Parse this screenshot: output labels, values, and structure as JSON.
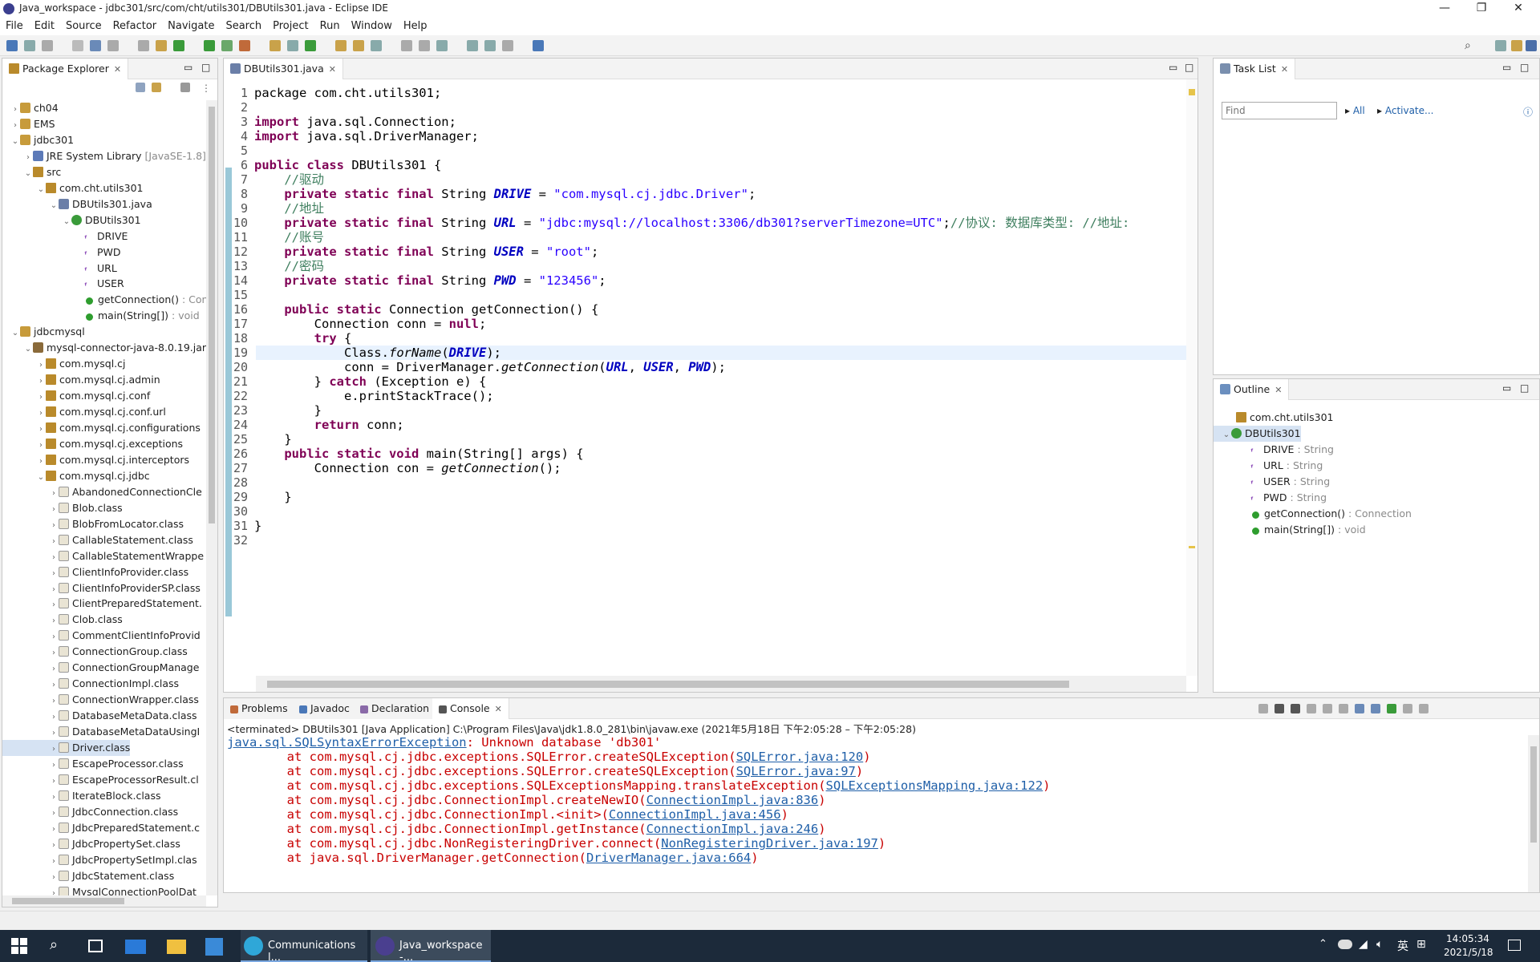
{
  "window": {
    "title": "Java_workspace - jdbc301/src/com/cht/utils301/DBUtils301.java - Eclipse IDE"
  },
  "menu": [
    "File",
    "Edit",
    "Source",
    "Refactor",
    "Navigate",
    "Search",
    "Project",
    "Run",
    "Window",
    "Help"
  ],
  "package_explorer": {
    "tab": "Package Explorer",
    "items": [
      {
        "label": "ch04",
        "depth": 0,
        "arrow": "›",
        "icon": "proj"
      },
      {
        "label": "EMS",
        "depth": 0,
        "arrow": "›",
        "icon": "proj"
      },
      {
        "label": "jdbc301",
        "depth": 0,
        "arrow": "⌄",
        "icon": "proj"
      },
      {
        "label": "JRE System Library",
        "extra": "[JavaSE-1.8]",
        "depth": 1,
        "arrow": "›",
        "icon": "lib"
      },
      {
        "label": "src",
        "depth": 1,
        "arrow": "⌄",
        "icon": "pkg"
      },
      {
        "label": "com.cht.utils301",
        "depth": 2,
        "arrow": "⌄",
        "icon": "pkg"
      },
      {
        "label": "DBUtils301.java",
        "depth": 3,
        "arrow": "⌄",
        "icon": "java"
      },
      {
        "label": "DBUtils301",
        "depth": 4,
        "arrow": "⌄",
        "icon": "class"
      },
      {
        "label": "DRIVE",
        "depth": 5,
        "arrow": "",
        "icon": "field"
      },
      {
        "label": "PWD",
        "depth": 5,
        "arrow": "",
        "icon": "field"
      },
      {
        "label": "URL",
        "depth": 5,
        "arrow": "",
        "icon": "field"
      },
      {
        "label": "USER",
        "depth": 5,
        "arrow": "",
        "icon": "field"
      },
      {
        "label": "getConnection()",
        "extra": ": Conn",
        "depth": 5,
        "arrow": "",
        "icon": "method"
      },
      {
        "label": "main(String[])",
        "extra": ": void",
        "depth": 5,
        "arrow": "",
        "icon": "method"
      },
      {
        "label": "jdbcmysql",
        "depth": 0,
        "arrow": "⌄",
        "icon": "proj"
      },
      {
        "label": "mysql-connector-java-8.0.19.jar",
        "depth": 1,
        "arrow": "⌄",
        "icon": "jar"
      },
      {
        "label": "com.mysql.cj",
        "depth": 2,
        "arrow": "›",
        "icon": "pkg"
      },
      {
        "label": "com.mysql.cj.admin",
        "depth": 2,
        "arrow": "›",
        "icon": "pkg"
      },
      {
        "label": "com.mysql.cj.conf",
        "depth": 2,
        "arrow": "›",
        "icon": "pkg"
      },
      {
        "label": "com.mysql.cj.conf.url",
        "depth": 2,
        "arrow": "›",
        "icon": "pkg"
      },
      {
        "label": "com.mysql.cj.configurations",
        "depth": 2,
        "arrow": "›",
        "icon": "pkg"
      },
      {
        "label": "com.mysql.cj.exceptions",
        "depth": 2,
        "arrow": "›",
        "icon": "pkg"
      },
      {
        "label": "com.mysql.cj.interceptors",
        "depth": 2,
        "arrow": "›",
        "icon": "pkg"
      },
      {
        "label": "com.mysql.cj.jdbc",
        "depth": 2,
        "arrow": "⌄",
        "icon": "pkg"
      },
      {
        "label": "AbandonedConnectionCle",
        "depth": 3,
        "arrow": "›",
        "icon": "file"
      },
      {
        "label": "Blob.class",
        "depth": 3,
        "arrow": "›",
        "icon": "file"
      },
      {
        "label": "BlobFromLocator.class",
        "depth": 3,
        "arrow": "›",
        "icon": "file"
      },
      {
        "label": "CallableStatement.class",
        "depth": 3,
        "arrow": "›",
        "icon": "file"
      },
      {
        "label": "CallableStatementWrappe",
        "depth": 3,
        "arrow": "›",
        "icon": "file"
      },
      {
        "label": "ClientInfoProvider.class",
        "depth": 3,
        "arrow": "›",
        "icon": "file"
      },
      {
        "label": "ClientInfoProviderSP.class",
        "depth": 3,
        "arrow": "›",
        "icon": "file"
      },
      {
        "label": "ClientPreparedStatement.",
        "depth": 3,
        "arrow": "›",
        "icon": "file"
      },
      {
        "label": "Clob.class",
        "depth": 3,
        "arrow": "›",
        "icon": "file"
      },
      {
        "label": "CommentClientInfoProvid",
        "depth": 3,
        "arrow": "›",
        "icon": "file"
      },
      {
        "label": "ConnectionGroup.class",
        "depth": 3,
        "arrow": "›",
        "icon": "file"
      },
      {
        "label": "ConnectionGroupManage",
        "depth": 3,
        "arrow": "›",
        "icon": "file"
      },
      {
        "label": "ConnectionImpl.class",
        "depth": 3,
        "arrow": "›",
        "icon": "file"
      },
      {
        "label": "ConnectionWrapper.class",
        "depth": 3,
        "arrow": "›",
        "icon": "file"
      },
      {
        "label": "DatabaseMetaData.class",
        "depth": 3,
        "arrow": "›",
        "icon": "file"
      },
      {
        "label": "DatabaseMetaDataUsingI",
        "depth": 3,
        "arrow": "›",
        "icon": "file"
      },
      {
        "label": "Driver.class",
        "depth": 3,
        "arrow": "›",
        "icon": "file",
        "selected": true
      },
      {
        "label": "EscapeProcessor.class",
        "depth": 3,
        "arrow": "›",
        "icon": "file"
      },
      {
        "label": "EscapeProcessorResult.cl",
        "depth": 3,
        "arrow": "›",
        "icon": "file"
      },
      {
        "label": "IterateBlock.class",
        "depth": 3,
        "arrow": "›",
        "icon": "file"
      },
      {
        "label": "JdbcConnection.class",
        "depth": 3,
        "arrow": "›",
        "icon": "file"
      },
      {
        "label": "JdbcPreparedStatement.c",
        "depth": 3,
        "arrow": "›",
        "icon": "file"
      },
      {
        "label": "JdbcPropertySet.class",
        "depth": 3,
        "arrow": "›",
        "icon": "file"
      },
      {
        "label": "JdbcPropertySetImpl.clas",
        "depth": 3,
        "arrow": "›",
        "icon": "file"
      },
      {
        "label": "JdbcStatement.class",
        "depth": 3,
        "arrow": "›",
        "icon": "file"
      },
      {
        "label": "MysqlConnectionPoolDat",
        "depth": 3,
        "arrow": "›",
        "icon": "file"
      }
    ]
  },
  "editor": {
    "tab": "DBUtils301.java",
    "lines": [
      [
        [
          "",
          "package com.cht.utils301;"
        ]
      ],
      [],
      [
        [
          "kw",
          "import"
        ],
        [
          "",
          " java.sql.Connection;"
        ]
      ],
      [
        [
          "kw",
          "import"
        ],
        [
          "",
          " java.sql.DriverManager;"
        ]
      ],
      [],
      [
        [
          "kw",
          "public class"
        ],
        [
          "",
          " DBUtils301 {"
        ]
      ],
      [
        [
          "",
          "    "
        ],
        [
          "cm",
          "//驱动"
        ]
      ],
      [
        [
          "",
          "    "
        ],
        [
          "kw",
          "private static final"
        ],
        [
          "",
          " String "
        ],
        [
          "cn",
          "DRIVE"
        ],
        [
          "",
          " = "
        ],
        [
          "st",
          "\"com.mysql.cj.jdbc.Driver\""
        ],
        [
          "",
          ";"
        ]
      ],
      [
        [
          "",
          "    "
        ],
        [
          "cm",
          "//地址"
        ]
      ],
      [
        [
          "",
          "    "
        ],
        [
          "kw",
          "private static final"
        ],
        [
          "",
          " String "
        ],
        [
          "cn",
          "URL"
        ],
        [
          "",
          " = "
        ],
        [
          "st",
          "\"jdbc:mysql://localhost:3306/db301?serverTimezone=UTC\""
        ],
        [
          "",
          ";"
        ],
        [
          "cm",
          "//协议: 数据库类型: //地址:"
        ]
      ],
      [
        [
          "",
          "    "
        ],
        [
          "cm",
          "//账号"
        ]
      ],
      [
        [
          "",
          "    "
        ],
        [
          "kw",
          "private static final"
        ],
        [
          "",
          " String "
        ],
        [
          "cn",
          "USER"
        ],
        [
          "",
          " = "
        ],
        [
          "st",
          "\"root\""
        ],
        [
          "",
          ";"
        ]
      ],
      [
        [
          "",
          "    "
        ],
        [
          "cm",
          "//密码"
        ]
      ],
      [
        [
          "",
          "    "
        ],
        [
          "kw",
          "private static final"
        ],
        [
          "",
          " String "
        ],
        [
          "cn",
          "PWD"
        ],
        [
          "",
          " = "
        ],
        [
          "st",
          "\"123456\""
        ],
        [
          "",
          ";"
        ]
      ],
      [],
      [
        [
          "",
          "    "
        ],
        [
          "kw",
          "public static"
        ],
        [
          "",
          " Connection getConnection() {"
        ]
      ],
      [
        [
          "",
          "        Connection conn = "
        ],
        [
          "kw",
          "null"
        ],
        [
          "",
          ";"
        ]
      ],
      [
        [
          "",
          "        "
        ],
        [
          "kw",
          "try"
        ],
        [
          "",
          " {"
        ]
      ],
      [
        [
          "",
          "            Class."
        ],
        [
          "it",
          "forName"
        ],
        [
          "",
          "("
        ],
        [
          "cn",
          "DRIVE"
        ],
        [
          "",
          ");"
        ]
      ],
      [
        [
          "",
          "            conn = DriverManager."
        ],
        [
          "it",
          "getConnection"
        ],
        [
          "",
          "("
        ],
        [
          "cn",
          "URL"
        ],
        [
          "",
          ", "
        ],
        [
          "cn",
          "USER"
        ],
        [
          "",
          ", "
        ],
        [
          "cn",
          "PWD"
        ],
        [
          "",
          ");"
        ]
      ],
      [
        [
          "",
          "        } "
        ],
        [
          "kw",
          "catch"
        ],
        [
          "",
          " (Exception e) {"
        ]
      ],
      [
        [
          "",
          "            e.printStackTrace();"
        ]
      ],
      [
        [
          "",
          "        }"
        ]
      ],
      [
        [
          "",
          "        "
        ],
        [
          "kw",
          "return"
        ],
        [
          "",
          " conn;"
        ]
      ],
      [
        [
          "",
          "    }"
        ]
      ],
      [
        [
          "",
          "    "
        ],
        [
          "kw",
          "public static void"
        ],
        [
          "",
          " main(String[] args) {"
        ]
      ],
      [
        [
          "",
          "        Connection con = "
        ],
        [
          "it",
          "getConnection"
        ],
        [
          "",
          "();"
        ]
      ],
      [],
      [
        [
          "",
          "    }"
        ]
      ],
      [],
      [
        [
          "",
          "}"
        ]
      ],
      []
    ]
  },
  "task_list": {
    "tab": "Task List",
    "find_placeholder": "Find",
    "all": "All",
    "activate": "Activate..."
  },
  "outline": {
    "tab": "Outline",
    "items": [
      {
        "label": "com.cht.utils301",
        "type": "",
        "depth": 0,
        "icon": "pkg"
      },
      {
        "label": "DBUtils301",
        "type": "",
        "depth": 0,
        "icon": "class",
        "selected": true
      },
      {
        "label": "DRIVE",
        "type": ": String",
        "depth": 1,
        "icon": "field"
      },
      {
        "label": "URL",
        "type": ": String",
        "depth": 1,
        "icon": "field"
      },
      {
        "label": "USER",
        "type": ": String",
        "depth": 1,
        "icon": "field"
      },
      {
        "label": "PWD",
        "type": ": String",
        "depth": 1,
        "icon": "field"
      },
      {
        "label": "getConnection()",
        "type": ": Connection",
        "depth": 1,
        "icon": "method"
      },
      {
        "label": "main(String[])",
        "type": ": void",
        "depth": 1,
        "icon": "method"
      }
    ]
  },
  "bottom_tabs": [
    "Problems",
    "Javadoc",
    "Declaration",
    "Console"
  ],
  "console": {
    "header": "<terminated> DBUtils301 [Java Application] C:\\Program Files\\Java\\jdk1.8.0_281\\bin\\javaw.exe  (2021年5月18日 下午2:05:28 – 下午2:05:28)",
    "lines": [
      [
        [
          "lnk",
          "java.sql.SQLSyntaxErrorException"
        ],
        [
          "",
          ": Unknown database 'db301'"
        ]
      ],
      [
        [
          "",
          "        at com.mysql.cj.jdbc.exceptions.SQLError.createSQLException("
        ],
        [
          "lnk",
          "SQLError.java:120"
        ],
        [
          "",
          ")"
        ]
      ],
      [
        [
          "",
          "        at com.mysql.cj.jdbc.exceptions.SQLError.createSQLException("
        ],
        [
          "lnk",
          "SQLError.java:97"
        ],
        [
          "",
          ")"
        ]
      ],
      [
        [
          "",
          "        at com.mysql.cj.jdbc.exceptions.SQLExceptionsMapping.translateException("
        ],
        [
          "lnk",
          "SQLExceptionsMapping.java:122"
        ],
        [
          "",
          ")"
        ]
      ],
      [
        [
          "",
          "        at com.mysql.cj.jdbc.ConnectionImpl.createNewIO("
        ],
        [
          "lnk",
          "ConnectionImpl.java:836"
        ],
        [
          "",
          ")"
        ]
      ],
      [
        [
          "",
          "        at com.mysql.cj.jdbc.ConnectionImpl.<init>("
        ],
        [
          "lnk",
          "ConnectionImpl.java:456"
        ],
        [
          "",
          ")"
        ]
      ],
      [
        [
          "",
          "        at com.mysql.cj.jdbc.ConnectionImpl.getInstance("
        ],
        [
          "lnk",
          "ConnectionImpl.java:246"
        ],
        [
          "",
          ")"
        ]
      ],
      [
        [
          "",
          "        at com.mysql.cj.jdbc.NonRegisteringDriver.connect("
        ],
        [
          "lnk",
          "NonRegisteringDriver.java:197"
        ],
        [
          "",
          ")"
        ]
      ],
      [
        [
          "",
          "        at java.sql.DriverManager.getConnection("
        ],
        [
          "lnk",
          "DriverManager.java:664"
        ],
        [
          "",
          ")"
        ]
      ]
    ]
  },
  "taskbar": {
    "apps": [
      "Communications l...",
      "Java_workspace -..."
    ],
    "ime": "英",
    "time": "14:05:34",
    "date": "2021/5/18"
  },
  "colors": {
    "accent": "#1f5fa8",
    "keyword": "#7f0055",
    "comment": "#3f7f5f",
    "string": "#2a00ff",
    "constant": "#0000c0",
    "error": "#c80000"
  }
}
